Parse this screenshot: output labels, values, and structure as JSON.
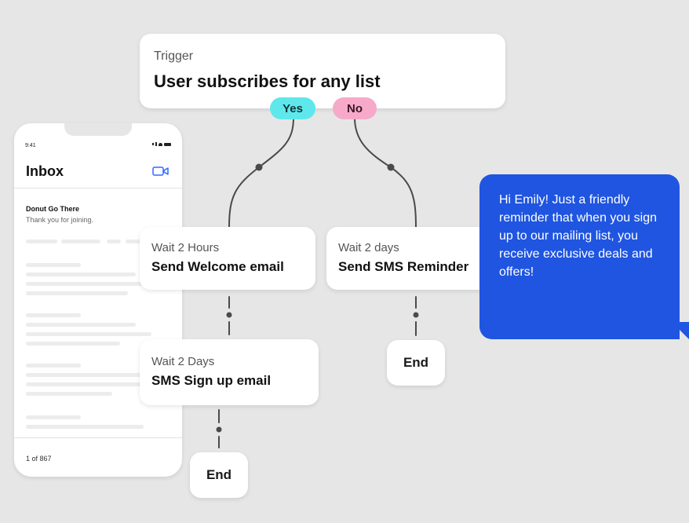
{
  "trigger": {
    "label": "Trigger",
    "title": "User subscribes for any list"
  },
  "branches": {
    "yes": "Yes",
    "no": "No"
  },
  "steps": [
    {
      "wait": "Wait 2 Hours",
      "action": "Send Welcome email"
    },
    {
      "wait": "Wait 2 days",
      "action": "Send SMS Reminder"
    },
    {
      "wait": "Wait 2 Days",
      "action": "SMS Sign up email"
    }
  ],
  "end_labels": [
    "End",
    "End"
  ],
  "phone": {
    "time": "9:41",
    "title": "Inbox",
    "sender": "Donut Go There",
    "preview": "Thank you for joining.",
    "count": "1 of 867"
  },
  "sms": {
    "text": "Hi Emily! Just a friendly reminder that when you sign up to our mailing list, you receive exclusive deals and offers!"
  },
  "colors": {
    "background": "#e6e6e6",
    "yes_badge": "#5ee8ec",
    "no_badge": "#f6a9c9",
    "sms_bubble": "#1f55e0",
    "connector": "#4a4a4a"
  },
  "icons": [
    "video-icon",
    "signal-icon",
    "wifi-icon",
    "battery-icon"
  ]
}
